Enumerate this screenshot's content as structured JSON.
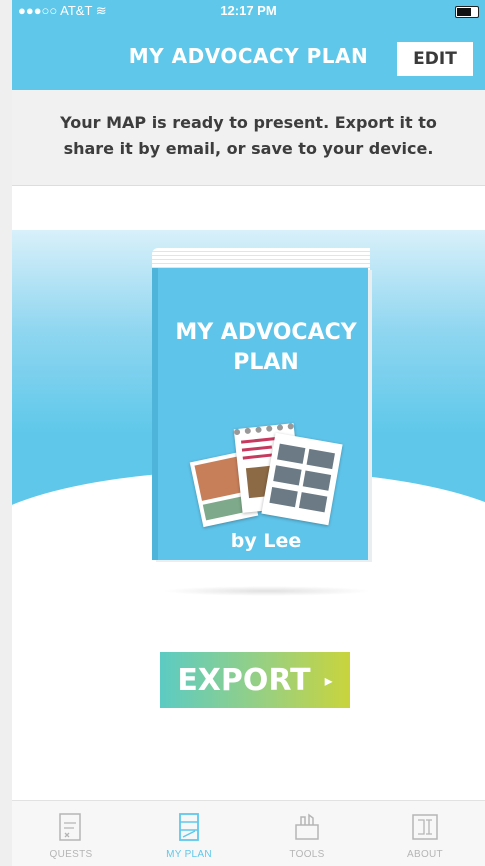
{
  "status_bar": {
    "carrier": "●●●○○ AT&T ≋",
    "time": "12:17 PM"
  },
  "nav": {
    "title": "MY ADVOCACY PLAN",
    "edit_label": "EDIT"
  },
  "notice": {
    "line1": "Your MAP is ready to present. Export it to",
    "line2": "share it by email, or save to your device."
  },
  "book": {
    "title_line1": "MY ADVOCACY",
    "title_line2": "PLAN",
    "byline": "by Lee"
  },
  "export": {
    "label": "EXPORT",
    "arrow": "▸"
  },
  "tabs": [
    {
      "label": "QUESTS",
      "icon": "quests-icon",
      "active": false
    },
    {
      "label": "MY PLAN",
      "icon": "my-plan-icon",
      "active": true
    },
    {
      "label": "TOOLS",
      "icon": "tools-icon",
      "active": false
    },
    {
      "label": "ABOUT",
      "icon": "about-icon",
      "active": false
    }
  ],
  "colors": {
    "accent": "#5fc8ea",
    "export_start": "#5ccbc3",
    "export_end": "#c9d43c",
    "tab_inactive": "#b5b5b5"
  }
}
